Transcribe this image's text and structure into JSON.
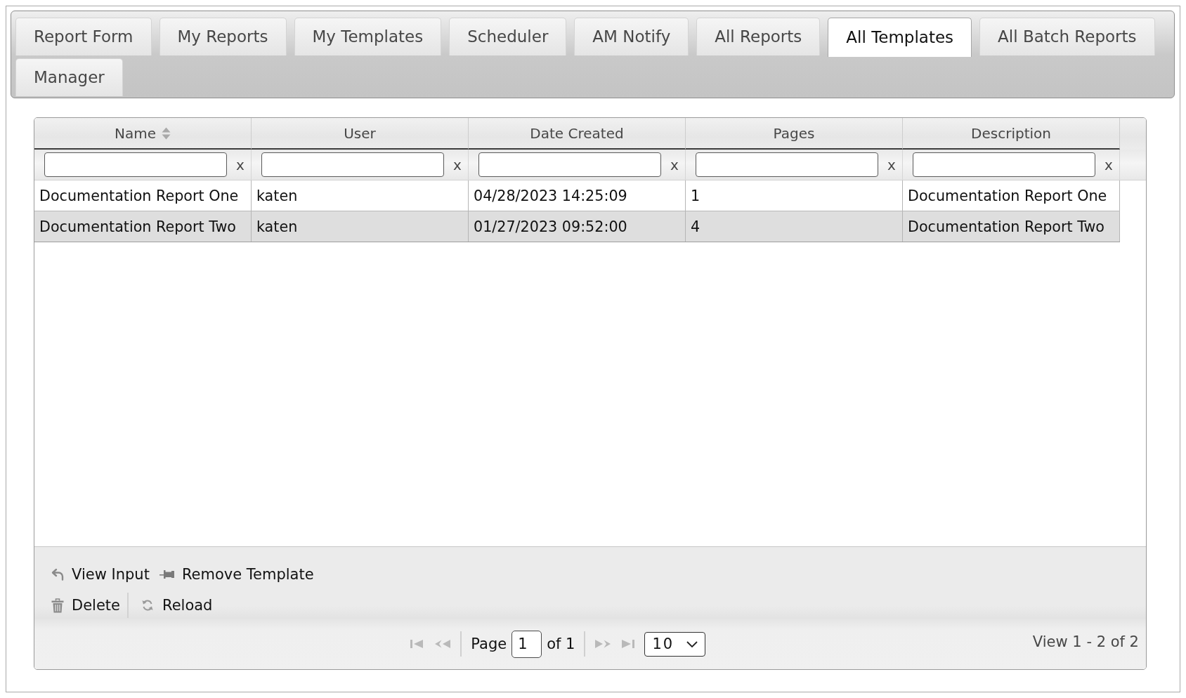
{
  "tabs": [
    {
      "label": "Report Form",
      "selected": false
    },
    {
      "label": "My Reports",
      "selected": false
    },
    {
      "label": "My Templates",
      "selected": false
    },
    {
      "label": "Scheduler",
      "selected": false
    },
    {
      "label": "AM Notify",
      "selected": false
    },
    {
      "label": "All Reports",
      "selected": false
    },
    {
      "label": "All Templates",
      "selected": true
    },
    {
      "label": "All Batch Reports",
      "selected": false
    },
    {
      "label": "Manager",
      "selected": false
    }
  ],
  "table": {
    "columns": [
      {
        "label": "Name",
        "sorted": true,
        "clear_filter": "x"
      },
      {
        "label": "User",
        "sorted": false,
        "clear_filter": "x"
      },
      {
        "label": "Date Created",
        "sorted": false,
        "clear_filter": "x"
      },
      {
        "label": "Pages",
        "sorted": false,
        "clear_filter": "x"
      },
      {
        "label": "Description",
        "sorted": false,
        "clear_filter": "x"
      }
    ],
    "rows": [
      {
        "cells": [
          "Documentation Report One",
          "katen",
          "04/28/2023 14:25:09",
          "1",
          "Documentation Report One"
        ],
        "selected": false
      },
      {
        "cells": [
          "Documentation Report Two",
          "katen",
          "01/27/2023 09:52:00",
          "4",
          "Documentation Report Two"
        ],
        "selected": true
      }
    ]
  },
  "toolbar": {
    "rows": [
      {
        "items": [
          {
            "kind": "back",
            "label": "View Input"
          },
          {
            "kind": "pin",
            "label": "Remove Template"
          }
        ]
      },
      {
        "items": [
          {
            "kind": "trash",
            "label": "Delete"
          },
          {
            "kind": "separator"
          },
          {
            "kind": "reload",
            "label": "Reload"
          }
        ]
      }
    ]
  },
  "pager": {
    "controls": [
      {
        "kind": "first",
        "disabled": true
      },
      {
        "kind": "prev",
        "disabled": true
      },
      {
        "kind": "separator"
      },
      {
        "kind": "label",
        "text": "Page"
      },
      {
        "kind": "page_input",
        "value": "1"
      },
      {
        "kind": "label",
        "text": "of 1"
      },
      {
        "kind": "separator"
      },
      {
        "kind": "next",
        "disabled": true
      },
      {
        "kind": "last",
        "disabled": true
      },
      {
        "kind": "page_size",
        "value": "10"
      }
    ],
    "record_info": "View 1 - 2 of 2"
  }
}
